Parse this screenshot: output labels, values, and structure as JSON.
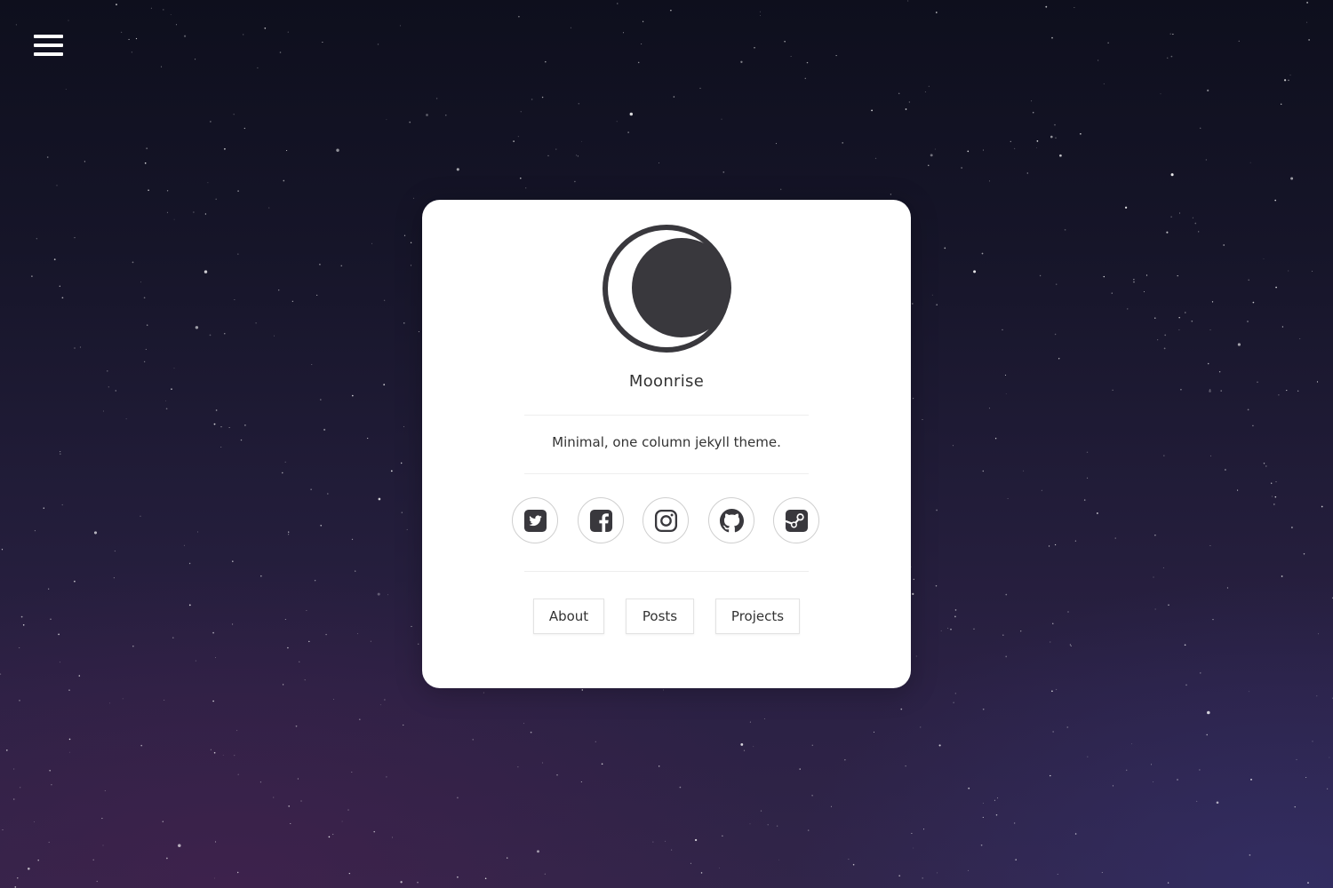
{
  "site": {
    "title": "Moonrise",
    "tagline": "Minimal, one column jekyll theme."
  },
  "menu": {
    "icon": "hamburger-menu-icon"
  },
  "logo": {
    "icon": "moon-crescent-icon",
    "color": "#39383d"
  },
  "social": [
    {
      "name": "twitter",
      "icon": "twitter-icon"
    },
    {
      "name": "facebook",
      "icon": "facebook-icon"
    },
    {
      "name": "instagram",
      "icon": "instagram-icon"
    },
    {
      "name": "github",
      "icon": "github-icon"
    },
    {
      "name": "steam",
      "icon": "steam-icon"
    }
  ],
  "nav": [
    {
      "label": "About"
    },
    {
      "label": "Posts"
    },
    {
      "label": "Projects"
    }
  ],
  "colors": {
    "card": "#ffffff",
    "text": "#333333",
    "icon": "#39383d",
    "sky_top": "#0e0f1d",
    "sky_bottom": "#312549"
  }
}
